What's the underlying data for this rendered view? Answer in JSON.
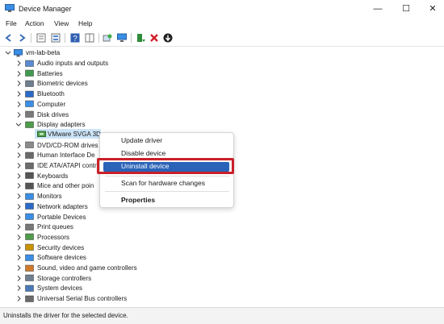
{
  "window": {
    "title": "Device Manager",
    "minimize_glyph": "—",
    "maximize_glyph": "☐",
    "close_glyph": "✕"
  },
  "menu": {
    "items": [
      "File",
      "Action",
      "View",
      "Help"
    ]
  },
  "toolbar": {
    "icons": [
      "back-icon",
      "forward-icon",
      "properties-icon",
      "list-icon",
      "help-icon",
      "view-icon",
      "scan-icon",
      "monitor-icon",
      "update-driver-icon",
      "uninstall-icon",
      "download-icon"
    ]
  },
  "tree": {
    "root": "vm-lab-beta",
    "categories": [
      "Audio inputs and outputs",
      "Batteries",
      "Biometric devices",
      "Bluetooth",
      "Computer",
      "Disk drives",
      "Display adapters",
      "DVD/CD-ROM drives",
      "Human Interface De",
      "IDE ATA/ATAPI contr",
      "Keyboards",
      "Mice and other poin",
      "Monitors",
      "Network adapters",
      "Portable Devices",
      "Print queues",
      "Processors",
      "Security devices",
      "Software devices",
      "Sound, video and game controllers",
      "Storage controllers",
      "System devices",
      "Universal Serial Bus controllers"
    ],
    "expanded_child": "VMware SVGA 3D"
  },
  "context_menu": {
    "items": [
      "Update driver",
      "Disable device",
      "Uninstall device",
      "Scan for hardware changes",
      "Properties"
    ],
    "highlighted": "Uninstall device",
    "accent_color": "#2a63b7",
    "highlight_border_color": "#c9202a"
  },
  "status": {
    "text": "Uninstalls the driver for the selected device."
  }
}
